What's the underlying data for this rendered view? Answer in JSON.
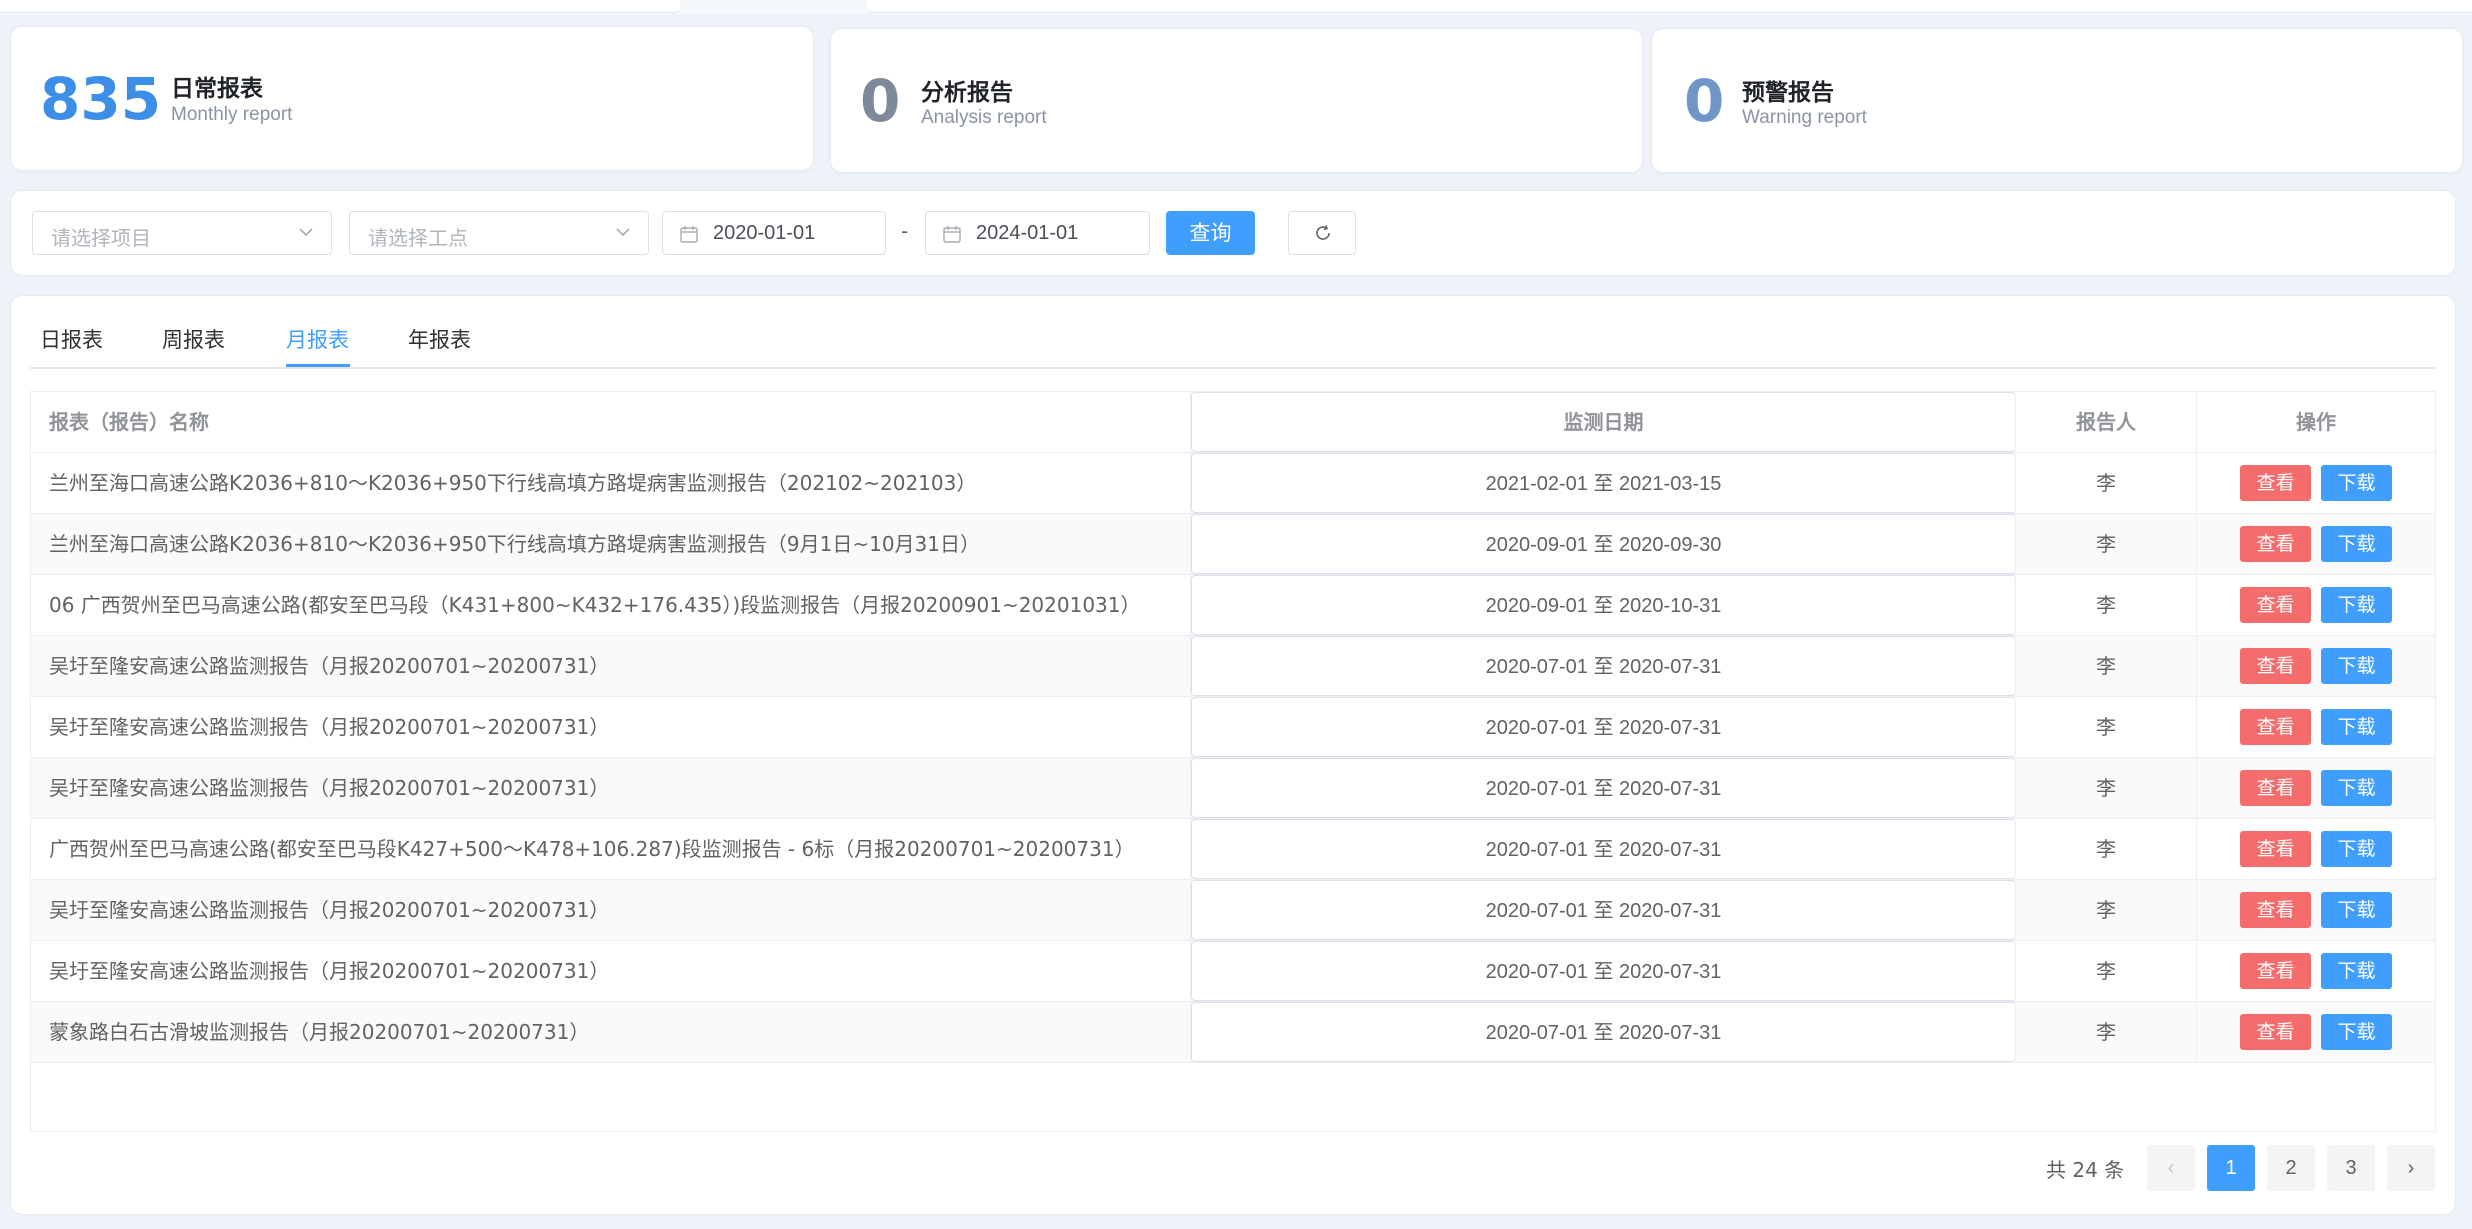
{
  "stats": [
    {
      "value": "835",
      "title": "日常报表",
      "subtitle": "Monthly report",
      "color": "#3d8ee6"
    },
    {
      "value": "0",
      "title": "分析报告",
      "subtitle": "Analysis report",
      "color": "#7c8a99"
    },
    {
      "value": "0",
      "title": "预警报告",
      "subtitle": "Warning report",
      "color": "#6f95c9"
    }
  ],
  "filters": {
    "project_placeholder": "请选择项目",
    "site_placeholder": "请选择工点",
    "start_date": "2020-01-01",
    "separator": "-",
    "end_date": "2024-01-01",
    "query_label": "查询"
  },
  "tabs": [
    "日报表",
    "周报表",
    "月报表",
    "年报表"
  ],
  "active_tab": "月报表",
  "table": {
    "headers": {
      "name": "报表（报告）名称",
      "date": "监测日期",
      "reporter": "报告人",
      "ops": "操作"
    },
    "view_label": "查看",
    "download_label": "下载",
    "rows": [
      {
        "name": "兰州至海口高速公路K2036+810～K2036+950下行线高填方路堤病害监测报告（202102~202103）",
        "date": "2021-02-01 至 2021-03-15",
        "reporter": "李"
      },
      {
        "name": "兰州至海口高速公路K2036+810～K2036+950下行线高填方路堤病害监测报告（9月1日~10月31日）",
        "date": "2020-09-01 至 2020-09-30",
        "reporter": "李"
      },
      {
        "name": "06 广西贺州至巴马高速公路(都安至巴马段（K431+800~K432+176.435）)段监测报告（月报20200901~20201031）",
        "date": "2020-09-01 至 2020-10-31",
        "reporter": "李"
      },
      {
        "name": "吴圩至隆安高速公路监测报告（月报20200701~20200731）",
        "date": "2020-07-01 至 2020-07-31",
        "reporter": "李"
      },
      {
        "name": "吴圩至隆安高速公路监测报告（月报20200701~20200731）",
        "date": "2020-07-01 至 2020-07-31",
        "reporter": "李"
      },
      {
        "name": "吴圩至隆安高速公路监测报告（月报20200701~20200731）",
        "date": "2020-07-01 至 2020-07-31",
        "reporter": "李"
      },
      {
        "name": "广西贺州至巴马高速公路(都安至巴马段K427+500～K478+106.287)段监测报告 - 6标（月报20200701~20200731）",
        "date": "2020-07-01 至 2020-07-31",
        "reporter": "李"
      },
      {
        "name": "吴圩至隆安高速公路监测报告（月报20200701~20200731）",
        "date": "2020-07-01 至 2020-07-31",
        "reporter": "李"
      },
      {
        "name": "吴圩至隆安高速公路监测报告（月报20200701~20200731）",
        "date": "2020-07-01 至 2020-07-31",
        "reporter": "李"
      },
      {
        "name": "蒙象路白石古滑坡监测报告（月报20200701~20200731）",
        "date": "2020-07-01 至 2020-07-31",
        "reporter": "李"
      }
    ]
  },
  "pagination": {
    "total_text": "共 24 条",
    "prev": "‹",
    "next": "›",
    "pages": [
      "1",
      "2",
      "3"
    ],
    "current": "1"
  },
  "colors": {
    "primary": "#409eff",
    "danger": "#f56c6c"
  }
}
